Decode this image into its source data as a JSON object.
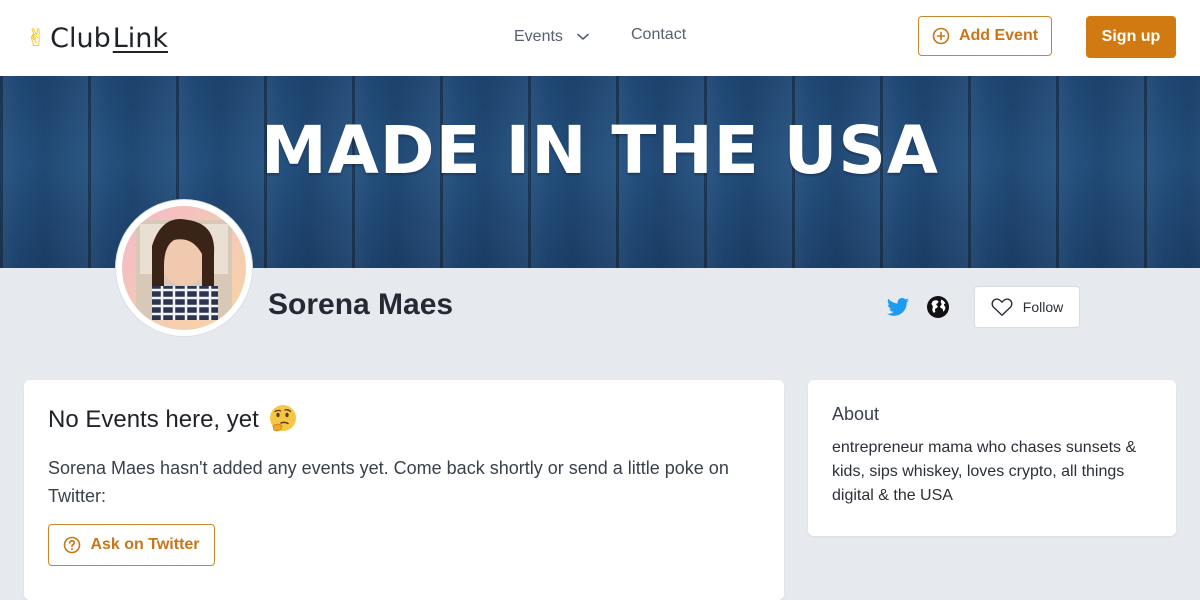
{
  "header": {
    "logo_part1": "Club",
    "logo_part2": "Link",
    "nav_events_label": "Events",
    "nav_contact_label": "Contact",
    "add_event_label": "Add Event",
    "signup_label": "Sign up"
  },
  "banner": {
    "text": "MADE IN THE USA"
  },
  "profile": {
    "name": "Sorena Maes",
    "follow_label": "Follow"
  },
  "events": {
    "title": "No Events here, yet",
    "message": "Sorena Maes hasn't added any events yet. Come back shortly or send a little poke on Twitter:",
    "ask_button_label": "Ask on Twitter"
  },
  "about": {
    "title": "About",
    "bio": "entrepreneur mama who chases sunsets & kids, sips whiskey, loves crypto, all things digital & the USA"
  },
  "colors": {
    "accent": "#d17a12",
    "twitter": "#1d9bf0",
    "banner_blue": "#24507f"
  },
  "icons": {
    "logo": "victory-hand-icon",
    "events_dropdown": "chevron-down-icon",
    "add_event": "plus-circle-icon",
    "twitter": "twitter-icon",
    "website": "globe-icon",
    "follow": "heart-icon",
    "thinking": "thinking-face-icon",
    "ask": "question-circle-icon"
  }
}
